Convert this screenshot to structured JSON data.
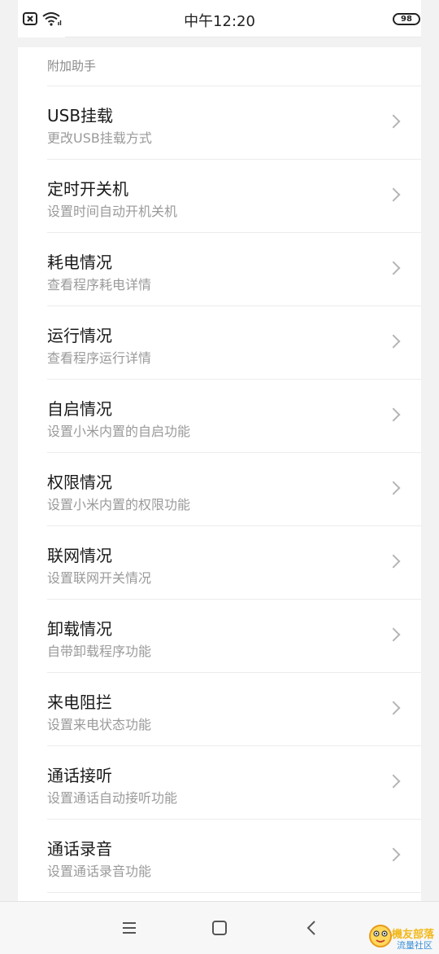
{
  "status_bar": {
    "time": "中午12:20",
    "battery": "98"
  },
  "section": {
    "header": "附加助手"
  },
  "items": [
    {
      "title": "USB挂载",
      "subtitle": "更改USB挂载方式"
    },
    {
      "title": "定时开关机",
      "subtitle": "设置时间自动开机关机"
    },
    {
      "title": "耗电情况",
      "subtitle": "查看程序耗电详情"
    },
    {
      "title": "运行情况",
      "subtitle": "查看程序运行详情"
    },
    {
      "title": "自启情况",
      "subtitle": "设置小米内置的自启功能"
    },
    {
      "title": "权限情况",
      "subtitle": "设置小米内置的权限功能"
    },
    {
      "title": "联网情况",
      "subtitle": "设置联网开关情况"
    },
    {
      "title": "卸载情况",
      "subtitle": "自带卸载程序功能"
    },
    {
      "title": "来电阻拦",
      "subtitle": "设置来电状态功能"
    },
    {
      "title": "通话接听",
      "subtitle": "设置通话自动接听功能"
    },
    {
      "title": "通话录音",
      "subtitle": "设置通话录音功能"
    }
  ],
  "watermark": {
    "top": "機友部落",
    "bottom": "流量社区"
  },
  "colors": {
    "background": "#f2f2f2",
    "card": "#ffffff",
    "title": "#1a1a1a",
    "subtitle": "#9a9a9a",
    "divider": "#ececec"
  }
}
